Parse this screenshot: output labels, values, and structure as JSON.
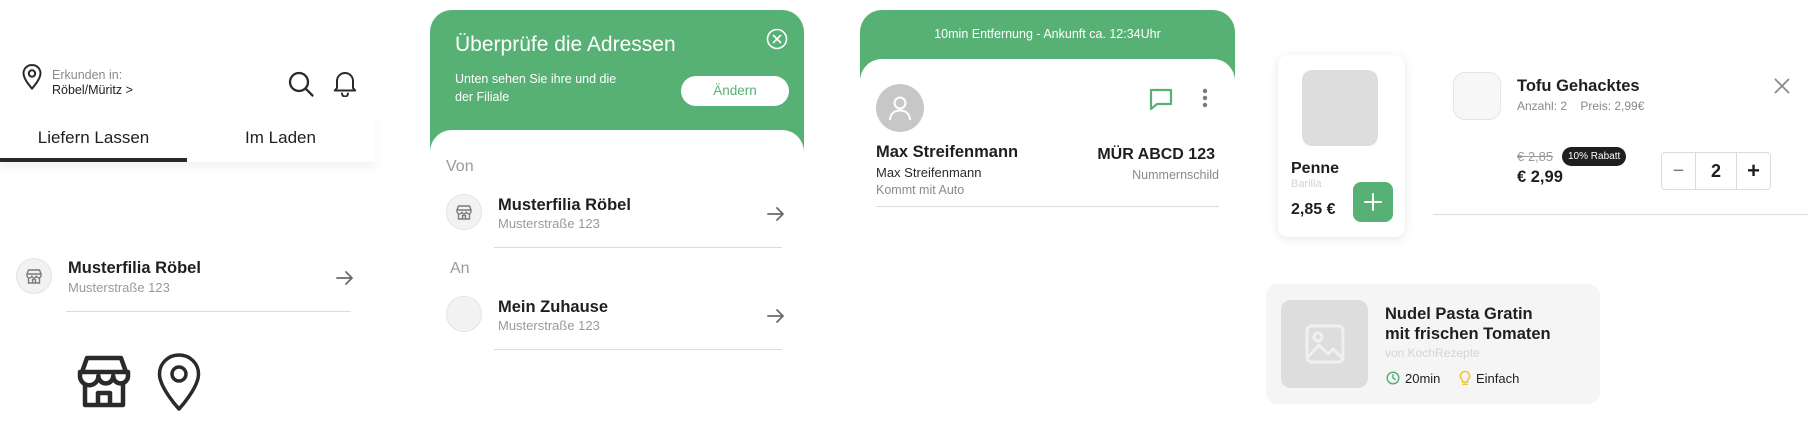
{
  "explore": {
    "label": "Erkunden in:",
    "location": "Röbel/Müritz >",
    "tabs": [
      "Liefern Lassen",
      "Im Laden"
    ],
    "store": {
      "name": "Musterfilia Röbel",
      "address": "Musterstraße 123"
    }
  },
  "address_check": {
    "title": "Überprüfe die Adressen",
    "subtitle": "Unten sehen Sie ihre und die der Filiale",
    "change_button": "Ändern",
    "from_label": "Von",
    "to_label": "An",
    "from": {
      "name": "Musterfilia Röbel",
      "address": "Musterstraße 123"
    },
    "to": {
      "name": "Mein Zuhause",
      "address": "Musterstraße 123"
    }
  },
  "driver": {
    "banner": "10min Entfernung - Ankunft ca. 12:34Uhr",
    "name": "Max Streifenmann",
    "name_small": "Max Streifenmann",
    "mode": "Kommt mit Auto",
    "plate": "MÜR ABCD 123",
    "plate_label": "Nummernschild"
  },
  "product": {
    "name": "Penne",
    "brand": "Barilla",
    "price": "2,85 €"
  },
  "cart_item": {
    "name": "Tofu Gehacktes",
    "meta": "Anzahl: 2    Preis: 2,99€",
    "old_price": "€ 2,85",
    "discount": "10% Rabatt",
    "price": "€ 2,99",
    "quantity": "2",
    "minus": "−",
    "plus": "+"
  },
  "recipe": {
    "title_line1": "Nudel Pasta Gratin",
    "title_line2": "mit frischen Tomaten",
    "author": "von KochRezepte",
    "time": "20min",
    "difficulty": "Einfach"
  },
  "colors": {
    "primary_green": "#57b174",
    "difficulty_yellow": "#f2c230",
    "text_dark": "#1f1f1f",
    "text_muted": "#9a9a9a"
  },
  "icons": [
    "location-pin-icon",
    "search-icon",
    "bell-icon",
    "store-icon",
    "arrow-right-icon",
    "close-circle-icon",
    "user-icon",
    "chat-icon",
    "more-vertical-icon",
    "plus-icon",
    "close-icon",
    "image-placeholder-icon",
    "clock-icon",
    "bulb-icon"
  ]
}
